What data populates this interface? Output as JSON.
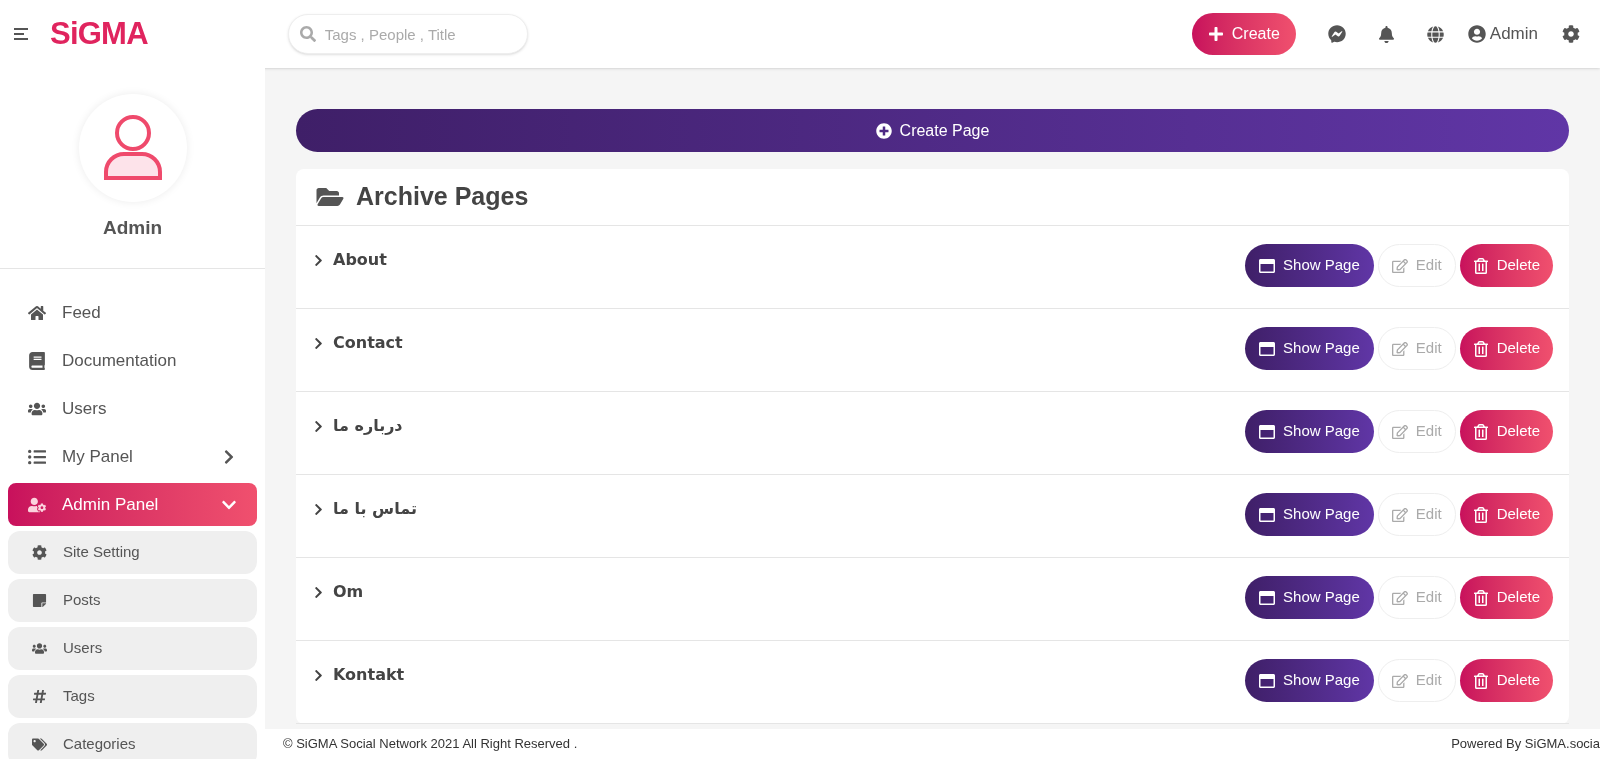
{
  "header": {
    "logo": "SiGMA",
    "search": {
      "placeholder": "Tags , People , Title"
    },
    "create_button": "Create",
    "user": "Admin"
  },
  "profile": {
    "name": "Admin"
  },
  "sidebar": {
    "items": [
      {
        "kind": "link",
        "label": "Feed",
        "selected": false
      },
      {
        "kind": "link",
        "label": "Documentation",
        "selected": false
      },
      {
        "kind": "link",
        "label": "Users",
        "selected": false
      },
      {
        "kind": "group",
        "label": "My Panel",
        "selected": false,
        "expanded": false
      },
      {
        "kind": "group",
        "label": "Admin Panel",
        "selected": true,
        "expanded": true
      },
      {
        "kind": "sub",
        "label": "Site Setting",
        "selected": false
      },
      {
        "kind": "sub",
        "label": "Posts",
        "selected": false
      },
      {
        "kind": "sub",
        "label": "Users",
        "selected": false
      },
      {
        "kind": "sub",
        "label": "Tags",
        "selected": false
      },
      {
        "kind": "sub",
        "label": "Categories",
        "selected": false
      }
    ]
  },
  "create_page_button": "Create Page",
  "archive": {
    "title": "Archive Pages",
    "rows": [
      {
        "title": "About",
        "show": "Show Page",
        "edit": "Edit",
        "delete": "Delete"
      },
      {
        "title": "Contact",
        "show": "Show Page",
        "edit": "Edit",
        "delete": "Delete"
      },
      {
        "title": "درباره ما",
        "show": "Show Page",
        "edit": "Edit",
        "delete": "Delete"
      },
      {
        "title": "تماس با ما",
        "show": "Show Page",
        "edit": "Edit",
        "delete": "Delete"
      },
      {
        "title": "Om",
        "show": "Show Page",
        "edit": "Edit",
        "delete": "Delete"
      },
      {
        "title": "Kontakt",
        "show": "Show Page",
        "edit": "Edit",
        "delete": "Delete"
      }
    ]
  },
  "footer": {
    "copyright": "© SiGMA Social Network 2021 All Right Reserved .",
    "powered": "Powered By SiGMA.socia"
  }
}
